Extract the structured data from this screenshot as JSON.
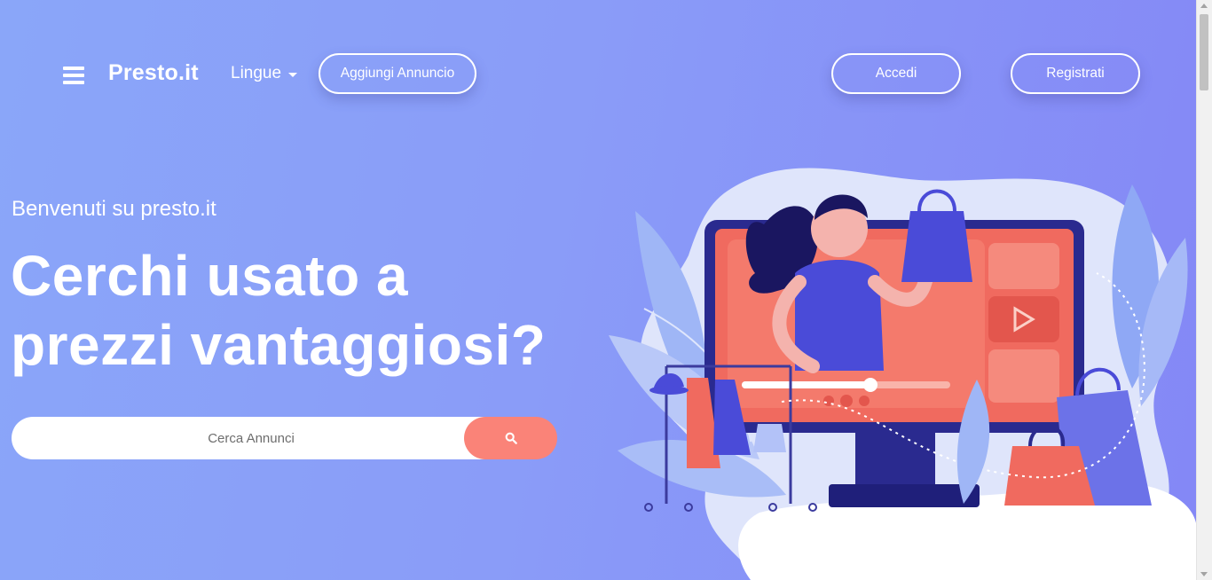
{
  "navbar": {
    "brand": "Presto.it",
    "languages_label": "Lingue",
    "add_listing_label": "Aggiungi Annuncio",
    "login_label": "Accedi",
    "register_label": "Registrati"
  },
  "hero": {
    "welcome": "Benvenuti su presto.it",
    "headline_line1": "Cerchi usato a",
    "headline_line2": "prezzi vantaggiosi?"
  },
  "search": {
    "placeholder": "Cerca Annunci",
    "value": ""
  },
  "icons": {
    "menu": "hamburger-icon",
    "dropdown": "caret-down-icon",
    "search": "search-icon"
  },
  "colors": {
    "gradient_start": "#8aa6f9",
    "gradient_end": "#8487f6",
    "accent_coral": "#fa8378",
    "illustration_indigo": "#4a4bd8"
  }
}
